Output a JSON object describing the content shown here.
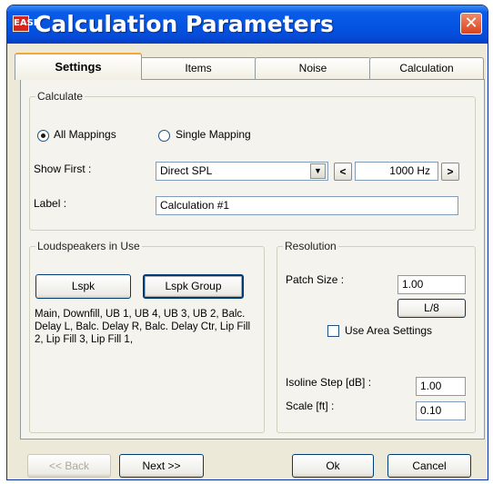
{
  "window": {
    "title": "Calculation Parameters",
    "icon": "app-logo-icon",
    "close_icon": "close-icon",
    "close_glyph": "✕"
  },
  "tabs": [
    {
      "label": "Settings",
      "active": true
    },
    {
      "label": "Items"
    },
    {
      "label": "Noise"
    },
    {
      "label": "Calculation"
    }
  ],
  "calculate": {
    "legend": "Calculate",
    "all_mappings_label": "All Mappings",
    "single_mapping_label": "Single Mapping",
    "selected": "All Mappings",
    "show_first_label": "Show First :",
    "show_first_value": "Direct SPL",
    "freq_prev": "<",
    "frequency_value": "1000 Hz",
    "freq_next": ">",
    "label_label": "Label :",
    "label_value": "Calculation #1"
  },
  "loudspeakers": {
    "legend": "Loudspeakers in Use",
    "lspk_button": "Lspk",
    "lspk_group_button": "Lspk Group",
    "list_text": "Main, Downfill, UB 1, UB 4, UB 3, UB 2, Balc. Delay L, Balc. Delay R, Balc. Delay Ctr, Lip Fill 2, Lip Fill 3, Lip Fill 1,"
  },
  "resolution": {
    "legend": "Resolution",
    "patch_size_label": "Patch Size :",
    "patch_size_value": "1.00",
    "l8_button": "L/8",
    "use_area_settings_label": "Use Area Settings",
    "use_area_settings_checked": false,
    "isoline_step_label": "Isoline Step [dB] :",
    "isoline_step_value": "1.00",
    "scale_label": "Scale [ft] :",
    "scale_value": "0.10"
  },
  "footer": {
    "back_label": "<< Back",
    "back_enabled": false,
    "next_label": "Next >>",
    "ok_label": "Ok",
    "cancel_label": "Cancel"
  }
}
